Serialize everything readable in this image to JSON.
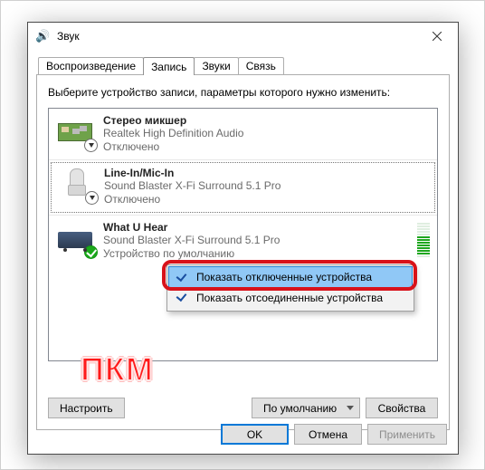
{
  "window": {
    "title": "Звук"
  },
  "tabs": {
    "items": [
      {
        "label": "Воспроизведение"
      },
      {
        "label": "Запись"
      },
      {
        "label": "Звуки"
      },
      {
        "label": "Связь"
      }
    ],
    "active": 1
  },
  "instruction": "Выберите устройство записи, параметры которого нужно изменить:",
  "devices": [
    {
      "name": "Стерео микшер",
      "driver": "Realtek High Definition Audio",
      "status": "Отключено"
    },
    {
      "name": "Line-In/Mic-In",
      "driver": "Sound Blaster X-Fi Surround 5.1 Pro",
      "status": "Отключено"
    },
    {
      "name": "What U Hear",
      "driver": "Sound Blaster X-Fi Surround 5.1 Pro",
      "status": "Устройство по умолчанию"
    }
  ],
  "context_menu": {
    "items": [
      {
        "label": "Показать отключенные устройства",
        "checked": true,
        "highlight": true
      },
      {
        "label": "Показать отсоединенные устройства",
        "checked": true,
        "highlight": false
      }
    ]
  },
  "buttons": {
    "configure": "Настроить",
    "default": "По умолчанию",
    "properties": "Свойства",
    "ok": "OK",
    "cancel": "Отмена",
    "apply": "Применить"
  },
  "annotation": "ПКМ"
}
